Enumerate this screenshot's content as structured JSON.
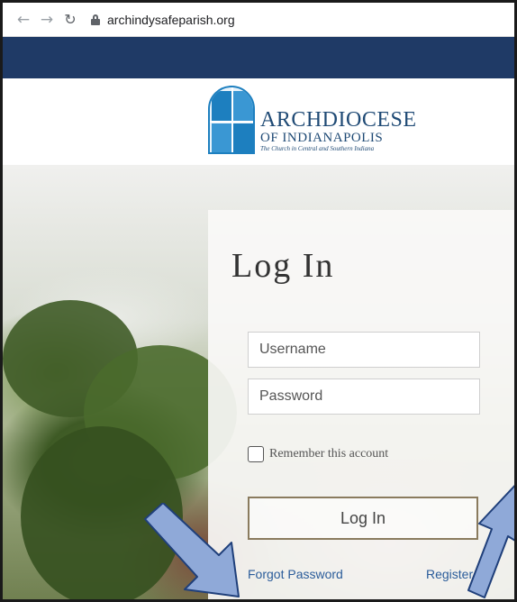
{
  "browser": {
    "back_icon": "arrow-left-icon",
    "forward_icon": "arrow-right-icon",
    "reload_icon": "reload-icon",
    "lock_icon": "lock-icon",
    "url": "archindysafeparish.org"
  },
  "header": {
    "logo": {
      "line1": "ARCHDIOCESE",
      "line2": "OF INDIANAPOLIS",
      "line3": "The Church in Central and Southern Indiana"
    }
  },
  "login": {
    "title": "Log In",
    "username_placeholder": "Username",
    "password_placeholder": "Password",
    "remember_label": "Remember this account",
    "submit_label": "Log In",
    "forgot_link": "Forgot Password",
    "register_link": "Register"
  },
  "colors": {
    "site_bar": "#1f3a66",
    "link": "#2a5c9a",
    "button_border": "#8a7b5e",
    "annotation_arrow": "#8fa9d8"
  }
}
